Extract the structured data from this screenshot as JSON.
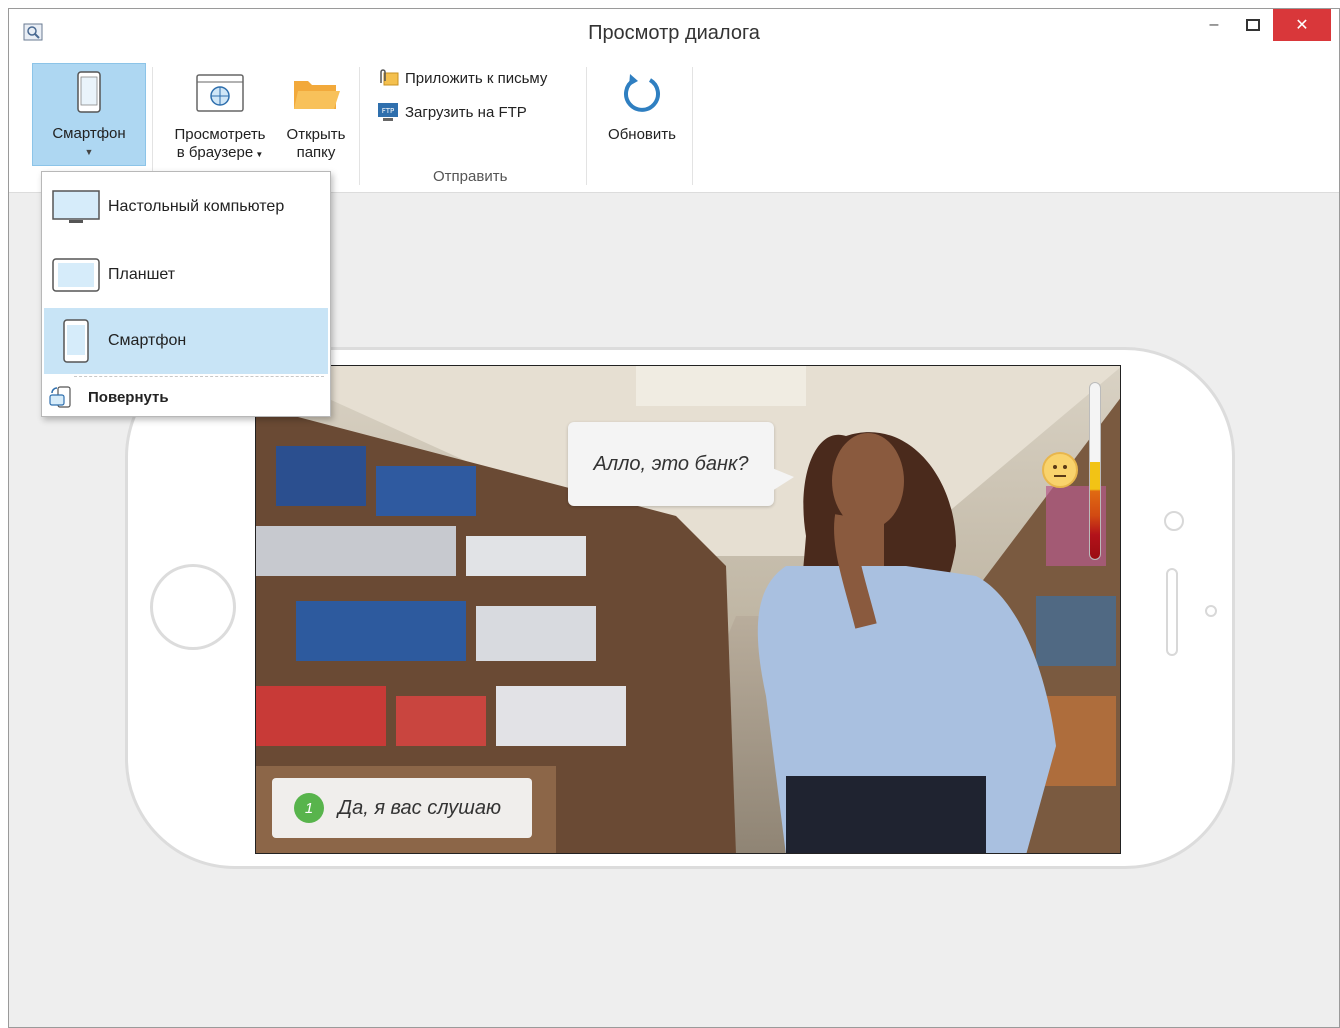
{
  "window": {
    "title": "Просмотр диалога",
    "minimize": "–",
    "maximize": "🗖",
    "close": "✕"
  },
  "ribbon": {
    "device_button": "Смартфон",
    "view_in_browser": [
      "Просмотреть",
      "в браузере"
    ],
    "open_folder": [
      "Открыть",
      "папку"
    ],
    "attach_to_email": "Приложить к письму",
    "upload_ftp": "Загрузить на FTP",
    "send_group_label": "Отправить",
    "refresh": "Обновить"
  },
  "device_menu": {
    "items": [
      {
        "label": "Настольный компьютер",
        "icon": "desktop-icon"
      },
      {
        "label": "Планшет",
        "icon": "tablet-icon"
      },
      {
        "label": "Смартфон",
        "icon": "smartphone-icon",
        "selected": true
      }
    ],
    "rotate": "Повернуть"
  },
  "preview": {
    "speech_bubble": "Алло, это банк?",
    "answer_number": "1",
    "answer_text": "Да, я вас слушаю",
    "mood_level": 0.55
  },
  "colors": {
    "accent": "#aed7f2",
    "selected": "#c8e4f6",
    "close_button": "#d9373a",
    "answer_badge": "#58b44c",
    "refresh_icon": "#2f7fc1"
  }
}
